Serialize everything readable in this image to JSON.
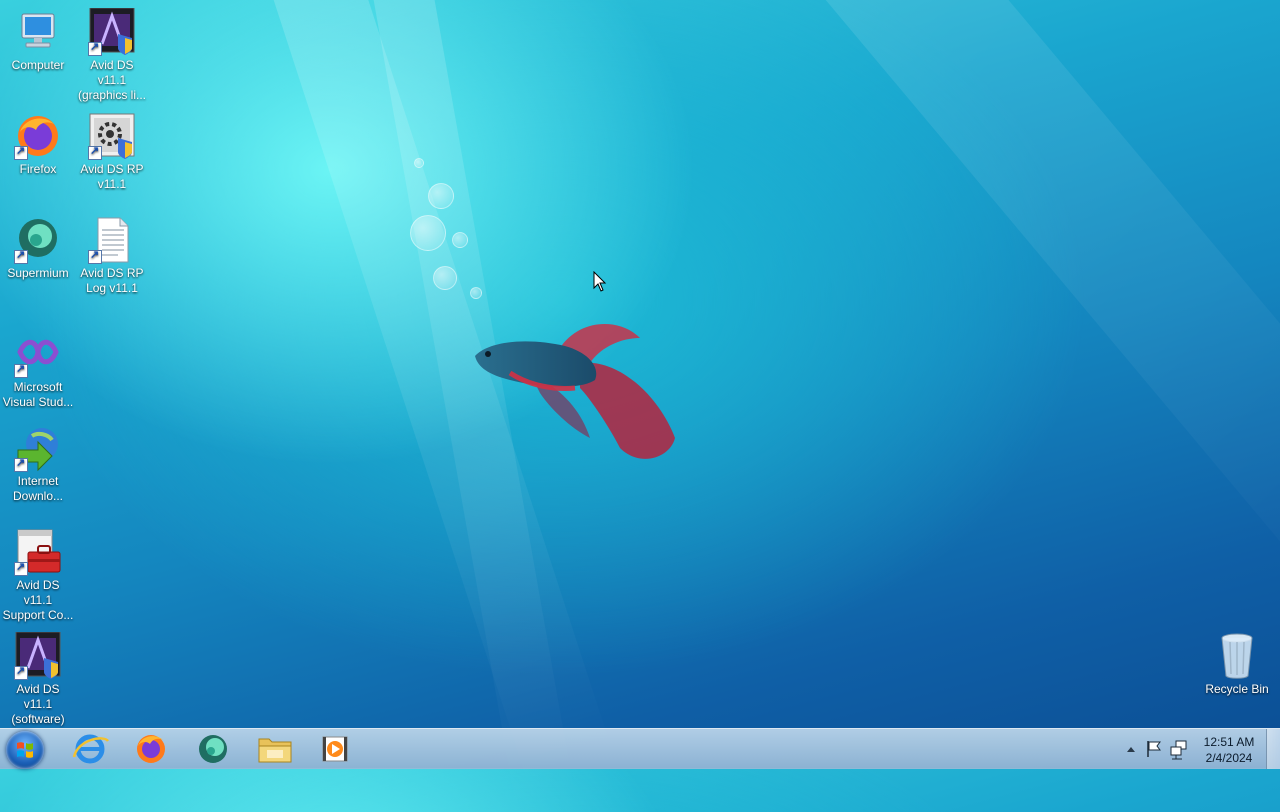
{
  "desktop": {
    "icons": [
      {
        "label": "Computer",
        "icon": "computer-icon"
      },
      {
        "label": "Avid DS v11.1 (graphics li...",
        "icon": "avid-ds-graphics-icon"
      },
      {
        "label": "Firefox",
        "icon": "firefox-icon"
      },
      {
        "label": "Avid DS RP v11.1",
        "icon": "avid-ds-rp-icon"
      },
      {
        "label": "Supermium",
        "icon": "supermium-icon"
      },
      {
        "label": "Avid DS RP Log v11.1",
        "icon": "text-document-icon"
      },
      {
        "label": "Microsoft Visual Stud...",
        "icon": "visual-studio-icon"
      },
      {
        "label": "Internet Downlo...",
        "icon": "internet-download-manager-icon"
      },
      {
        "label": "Avid DS v11.1 Support Co...",
        "icon": "toolbox-icon"
      },
      {
        "label": "Avid DS v11.1 (software)",
        "icon": "avid-ds-software-icon"
      },
      {
        "label": "Recycle Bin",
        "icon": "recycle-bin-icon"
      }
    ]
  },
  "taskbar": {
    "pinned": [
      {
        "name": "Internet Explorer",
        "icon": "internet-explorer-icon"
      },
      {
        "name": "Firefox",
        "icon": "firefox-icon"
      },
      {
        "name": "Supermium",
        "icon": "supermium-icon"
      },
      {
        "name": "Windows Explorer",
        "icon": "folder-icon"
      },
      {
        "name": "Media Player",
        "icon": "media-player-icon"
      }
    ],
    "clock": {
      "time": "12:51 AM",
      "date": "2/4/2024"
    }
  }
}
